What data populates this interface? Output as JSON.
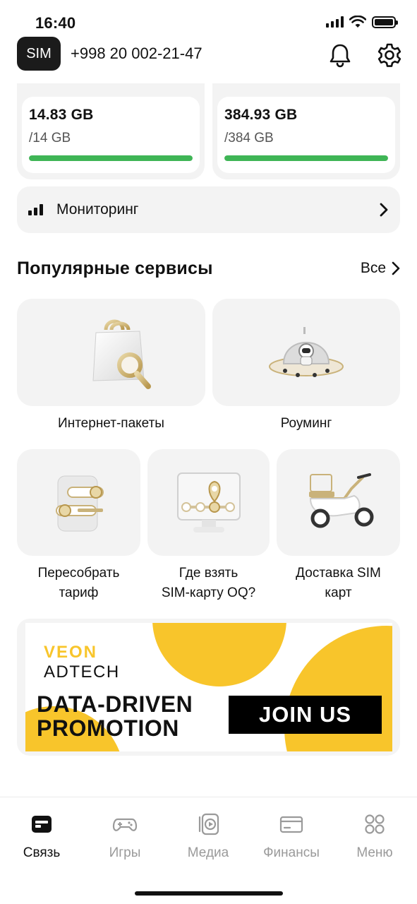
{
  "status_bar": {
    "time": "16:40"
  },
  "header": {
    "sim_label": "SIM",
    "phone_number": "+998 20 002-21-47"
  },
  "data_cards": [
    {
      "value": "14.83 GB",
      "total": "/14 GB",
      "progress": 1.0
    },
    {
      "value": "384.93 GB",
      "total": "/384 GB",
      "progress": 1.0
    }
  ],
  "monitoring": {
    "label": "Мониторинг"
  },
  "services": {
    "title": "Популярные сервисы",
    "all_label": "Все",
    "items": [
      {
        "label": "Интернет-пакеты",
        "icon": "shopping-bag-search-icon"
      },
      {
        "label": "Роуминг",
        "icon": "ufo-astronaut-icon"
      },
      {
        "label": "Пересобрать\nтариф",
        "icon": "tariff-builder-icon"
      },
      {
        "label": "Где взять\nSIM-карту OQ?",
        "icon": "map-location-icon"
      },
      {
        "label": "Доставка SIM\nкарт",
        "icon": "scooter-delivery-icon"
      }
    ]
  },
  "banner": {
    "brand_line1": "VEON",
    "brand_line2": "ADTECH",
    "headline": "DATA-DRIVEN\nPROMOTION",
    "cta": "JOIN US",
    "accent_color": "#f8c52b"
  },
  "bottom_nav": [
    {
      "label": "Связь",
      "icon": "sim-card-icon",
      "active": true
    },
    {
      "label": "Игры",
      "icon": "gamepad-icon",
      "active": false
    },
    {
      "label": "Медиа",
      "icon": "media-play-icon",
      "active": false
    },
    {
      "label": "Финансы",
      "icon": "credit-card-icon",
      "active": false
    },
    {
      "label": "Меню",
      "icon": "grid-menu-icon",
      "active": false
    }
  ]
}
